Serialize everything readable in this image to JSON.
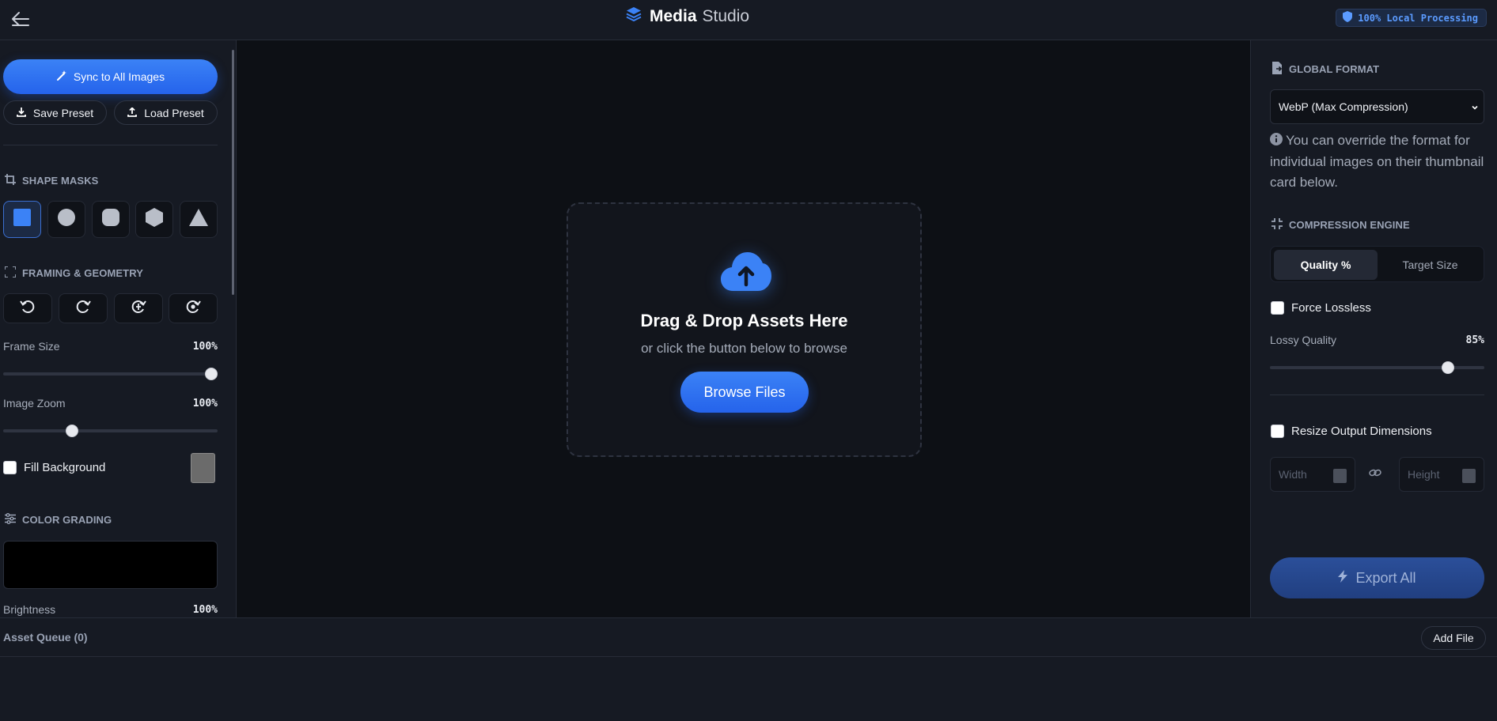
{
  "header": {
    "brand_bold": "Media",
    "brand_light": "Studio",
    "badge": "100% Local Processing"
  },
  "left": {
    "sync_button": "Sync to All Images",
    "save_preset": "Save Preset",
    "load_preset": "Load Preset",
    "shape_masks_title": "SHAPE MASKS",
    "shapes": [
      "square-icon",
      "circle-icon",
      "rounded-square-icon",
      "hexagon-icon",
      "triangle-icon"
    ],
    "framing_title": "FRAMING & GEOMETRY",
    "frame_size_label": "Frame Size",
    "frame_size_value": "100%",
    "frame_size_level": 1.0,
    "image_zoom_label": "Image Zoom",
    "image_zoom_value": "100%",
    "image_zoom_level": 0.31,
    "fill_background_label": "Fill Background",
    "fill_background_checked": false,
    "fill_color": "#6b6b6b",
    "color_grading_title": "COLOR GRADING",
    "brightness_label": "Brightness",
    "brightness_value": "100%"
  },
  "center": {
    "drop_title": "Drag & Drop Assets Here",
    "drop_subtitle": "or click the button below to browse",
    "browse_button": "Browse Files"
  },
  "right": {
    "global_format_title": "GLOBAL FORMAT",
    "format_selected": "WebP (Max Compression)",
    "format_info": "You can override the format for individual images on their thumbnail card below.",
    "compression_title": "COMPRESSION ENGINE",
    "tab_quality": "Quality %",
    "tab_target": "Target Size",
    "force_lossless_label": "Force Lossless",
    "force_lossless_checked": false,
    "lossy_quality_label": "Lossy Quality",
    "lossy_quality_value": "85%",
    "lossy_quality_level": 0.85,
    "resize_label": "Resize Output Dimensions",
    "resize_checked": false,
    "width_placeholder": "Width",
    "height_placeholder": "Height",
    "export_button": "Export All"
  },
  "queue": {
    "title": "Asset Queue (0)",
    "add_file": "Add File"
  },
  "colors": {
    "accent": "#3b82f6",
    "background": "#12151d",
    "panel": "#161a23"
  }
}
